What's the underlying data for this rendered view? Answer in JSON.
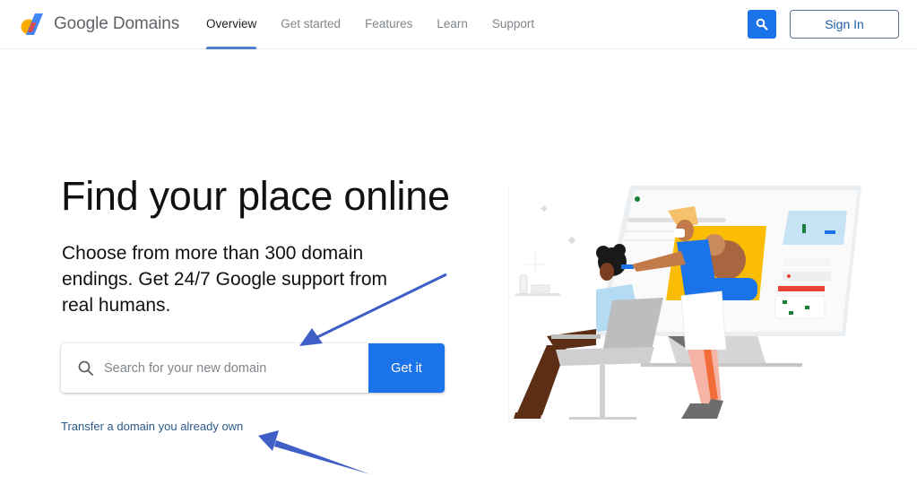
{
  "header": {
    "brand": "Google Domains",
    "logo_icon": "google-domains-logo",
    "nav": [
      {
        "label": "Overview",
        "active": true
      },
      {
        "label": "Get started",
        "active": false
      },
      {
        "label": "Features",
        "active": false
      },
      {
        "label": "Learn",
        "active": false
      },
      {
        "label": "Support",
        "active": false
      }
    ],
    "search_icon": "search-icon",
    "sign_in_label": "Sign In"
  },
  "hero": {
    "title": "Find your place online",
    "subtitle": "Choose from more than 300 domain endings. Get 24/7 Google support from real humans.",
    "search": {
      "placeholder": "Search for your new domain",
      "value": "",
      "icon": "search-icon",
      "button_label": "Get it"
    },
    "transfer_link": "Transfer a domain you already own"
  },
  "illustration": {
    "description": "Hairdresser styling a seated client in front of a large monitor"
  },
  "annotations": {
    "arrow_color": "#3f5fc7",
    "arrows": [
      "points-to-search-field",
      "points-to-transfer-link"
    ]
  },
  "colors": {
    "primary_blue": "#1a73e8",
    "nav_underline": "#4a7fd4",
    "link_blue": "#2b5a8a",
    "text_dark": "#111111",
    "text_muted": "#80868b"
  }
}
